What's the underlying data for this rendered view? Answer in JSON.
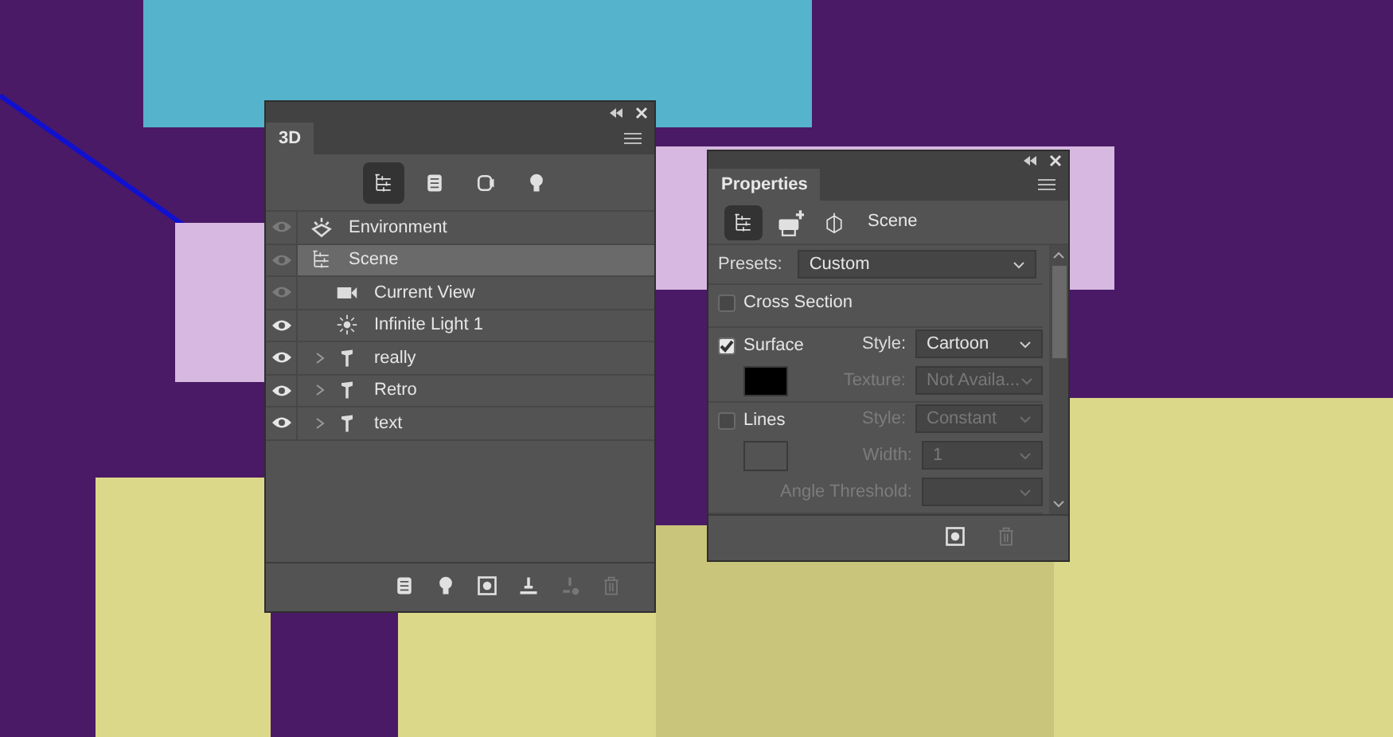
{
  "panel_3d": {
    "tab": "3D",
    "toolbar": [
      {
        "kind": "scene",
        "selected": true
      },
      {
        "kind": "mesh",
        "selected": false
      },
      {
        "kind": "material",
        "selected": false
      },
      {
        "kind": "light",
        "selected": false
      }
    ],
    "layers": [
      {
        "kind": "environment",
        "label": "Environment",
        "visible": false,
        "selected": false
      },
      {
        "kind": "scene",
        "label": "Scene",
        "visible": false,
        "selected": true,
        "children": [
          {
            "kind": "camera",
            "label": "Current View",
            "visible": false,
            "selected": false
          },
          {
            "kind": "light",
            "label": "Infinite Light 1",
            "visible": true,
            "selected": false
          },
          {
            "kind": "mesh",
            "label": "really",
            "visible": true,
            "selected": false,
            "expanded": false
          },
          {
            "kind": "mesh",
            "label": "Retro",
            "visible": true,
            "selected": false,
            "expanded": false
          },
          {
            "kind": "mesh",
            "label": "text",
            "visible": true,
            "selected": false,
            "expanded": false
          }
        ]
      }
    ],
    "footer": [
      {
        "kind": "mesh",
        "disabled": false
      },
      {
        "kind": "light",
        "disabled": false
      },
      {
        "kind": "render",
        "disabled": false
      },
      {
        "kind": "ground",
        "disabled": false
      },
      {
        "kind": "drop",
        "disabled": true
      },
      {
        "kind": "trash",
        "disabled": true
      }
    ]
  },
  "properties": {
    "tab": "Properties",
    "modes": [
      {
        "kind": "scene",
        "selected": true
      },
      {
        "kind": "printer",
        "selected": false
      },
      {
        "kind": "cross",
        "selected": false
      }
    ],
    "heading": "Scene",
    "presets": {
      "label": "Presets:",
      "value": "Custom"
    },
    "sections": [
      {
        "label": "Cross Section",
        "checked": false
      },
      {
        "label": "Surface",
        "checked": true,
        "color": "#000000",
        "fields": [
          {
            "label": "Style:",
            "value": "Cartoon",
            "disabled": false
          },
          {
            "label": "Texture:",
            "value": "Not Availa...",
            "disabled": true
          }
        ]
      },
      {
        "label": "Lines",
        "checked": false,
        "fields": [
          {
            "label": "Style:",
            "value": "Constant",
            "disabled": true
          },
          {
            "label": "Width:",
            "value": "1",
            "disabled": true,
            "narrow": true
          },
          {
            "label": "Angle Threshold:",
            "disabled": true,
            "narrow": true
          }
        ]
      }
    ],
    "footer": [
      {
        "kind": "render",
        "disabled": false
      },
      {
        "kind": "trash",
        "disabled": true
      }
    ]
  }
}
